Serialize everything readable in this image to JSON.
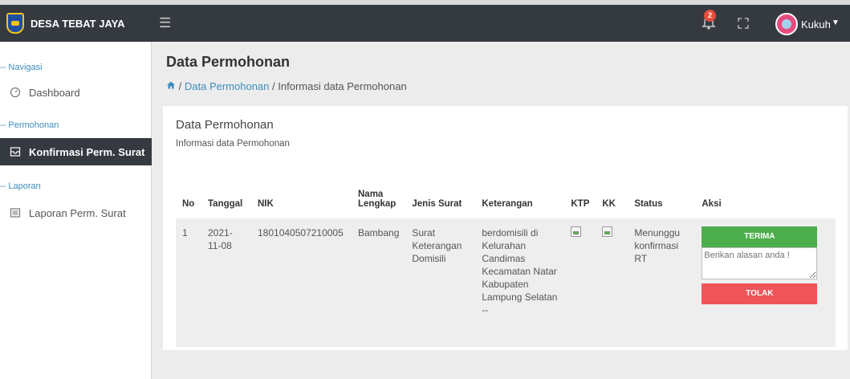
{
  "app": {
    "brand": "DESA TEBAT JAYA",
    "brand_logo": "village-emblem-logo"
  },
  "topbar": {
    "menu_icon": "hamburger-icon",
    "notif_icon": "bell-icon",
    "notif_count": "2",
    "fullscreen_icon": "expand-icon",
    "user_name": "Kukuh",
    "user_caret": "chevron-down-icon"
  },
  "sidebar": {
    "headers": [
      "-- Navigasi",
      "-- Permohonan",
      "-- Laporan"
    ],
    "items": [
      {
        "label": "Dashboard",
        "icon": "dashboard-gauge-icon"
      },
      {
        "label": "Konfirmasi Perm. Surat",
        "icon": "inbox-icon",
        "active": true
      },
      {
        "label": "Laporan Perm. Surat",
        "icon": "report-icon"
      }
    ]
  },
  "page": {
    "title": "Data Permohonan",
    "breadcrumb": {
      "home_icon": "home-icon",
      "sep": "/",
      "link": "Data Permohonan",
      "current": "Informasi data Permohonan"
    }
  },
  "card": {
    "title": "Data Permohonan",
    "subtitle": "Informasi data Permohonan",
    "table": {
      "columns": [
        "No",
        "Tanggal",
        "NIK",
        "Nama Lengkap",
        "Jenis Surat",
        "Keterangan",
        "KTP",
        "KK",
        "Status",
        "Aksi"
      ],
      "rows": [
        {
          "no": "1",
          "tanggal": "2021-11-08",
          "nik": "1801040507210005",
          "nama": "Bambang",
          "jenis_surat": "Surat Keterangan Domisili",
          "keterangan": "berdomisili di Kelurahan Candimas Kecamatan Natar Kabupaten Lampung Selatan --",
          "ktp": "broken-image-icon",
          "kk": "broken-image-icon",
          "status": "Menunggu konfirmasi RT",
          "terima_label": "TERIMA",
          "reason_placeholder": "Berikan alasan anda !",
          "tolak_label": "TOLAK"
        }
      ]
    }
  },
  "colors": {
    "topbar": "#343a40",
    "link": "#3c8dbc",
    "accept": "#4cae4c",
    "reject": "#f0545b",
    "badge": "#e74c3c"
  }
}
